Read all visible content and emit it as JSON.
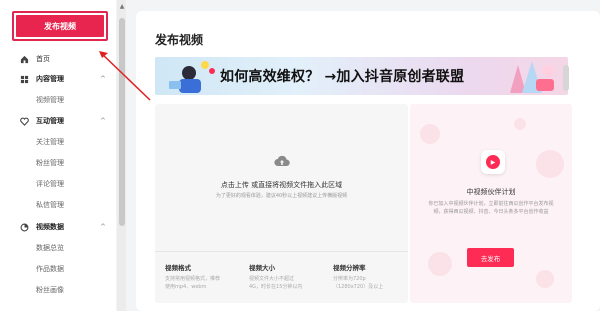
{
  "sidebar": {
    "publish_label": "发布视频",
    "items": [
      {
        "label": "首页",
        "icon": "home-icon",
        "type": "top"
      },
      {
        "label": "内容管理",
        "icon": "grid-icon",
        "type": "group",
        "chevron": "^"
      },
      {
        "label": "视频管理",
        "type": "sub"
      },
      {
        "label": "互动管理",
        "icon": "heart-icon",
        "type": "group",
        "chevron": "^"
      },
      {
        "label": "关注管理",
        "type": "sub"
      },
      {
        "label": "粉丝管理",
        "type": "sub"
      },
      {
        "label": "评论管理",
        "type": "sub"
      },
      {
        "label": "私信管理",
        "type": "sub"
      },
      {
        "label": "视频数据",
        "icon": "data-icon",
        "type": "group",
        "chevron": "^"
      },
      {
        "label": "数据总览",
        "type": "sub"
      },
      {
        "label": "作品数据",
        "type": "sub"
      },
      {
        "label": "粉丝画像",
        "type": "sub"
      }
    ]
  },
  "main": {
    "title": "发布视频",
    "banner_text": "如何高效维权？ →加入抖音原创者联盟",
    "upload": {
      "title": "点击上传 或直接将视频文件拖入此区域",
      "subtitle": "为了更好的观看体验，建议40秒以上视频建议上传横版视频",
      "specs": [
        {
          "title": "视频格式",
          "desc1": "支持常用视频格式，推荐",
          "desc2": "使用mp4、webm"
        },
        {
          "title": "视频大小",
          "desc1": "视频文件大小不超过",
          "desc2": "4G，时长在15分钟以内"
        },
        {
          "title": "视频分辨率",
          "desc1": "分辨率为720p",
          "desc2": "（1280x720）及以上"
        }
      ]
    },
    "partner": {
      "title": "中视频伙伴计划",
      "desc": "你已加入中视频伙伴计划，立即前往西瓜创作平台发布视频，获得西瓜视频、抖音、今日头条多平台创作收益",
      "button": "去发布"
    }
  },
  "colors": {
    "accent": "#fe2c55",
    "highlight_border": "#e0264f"
  }
}
